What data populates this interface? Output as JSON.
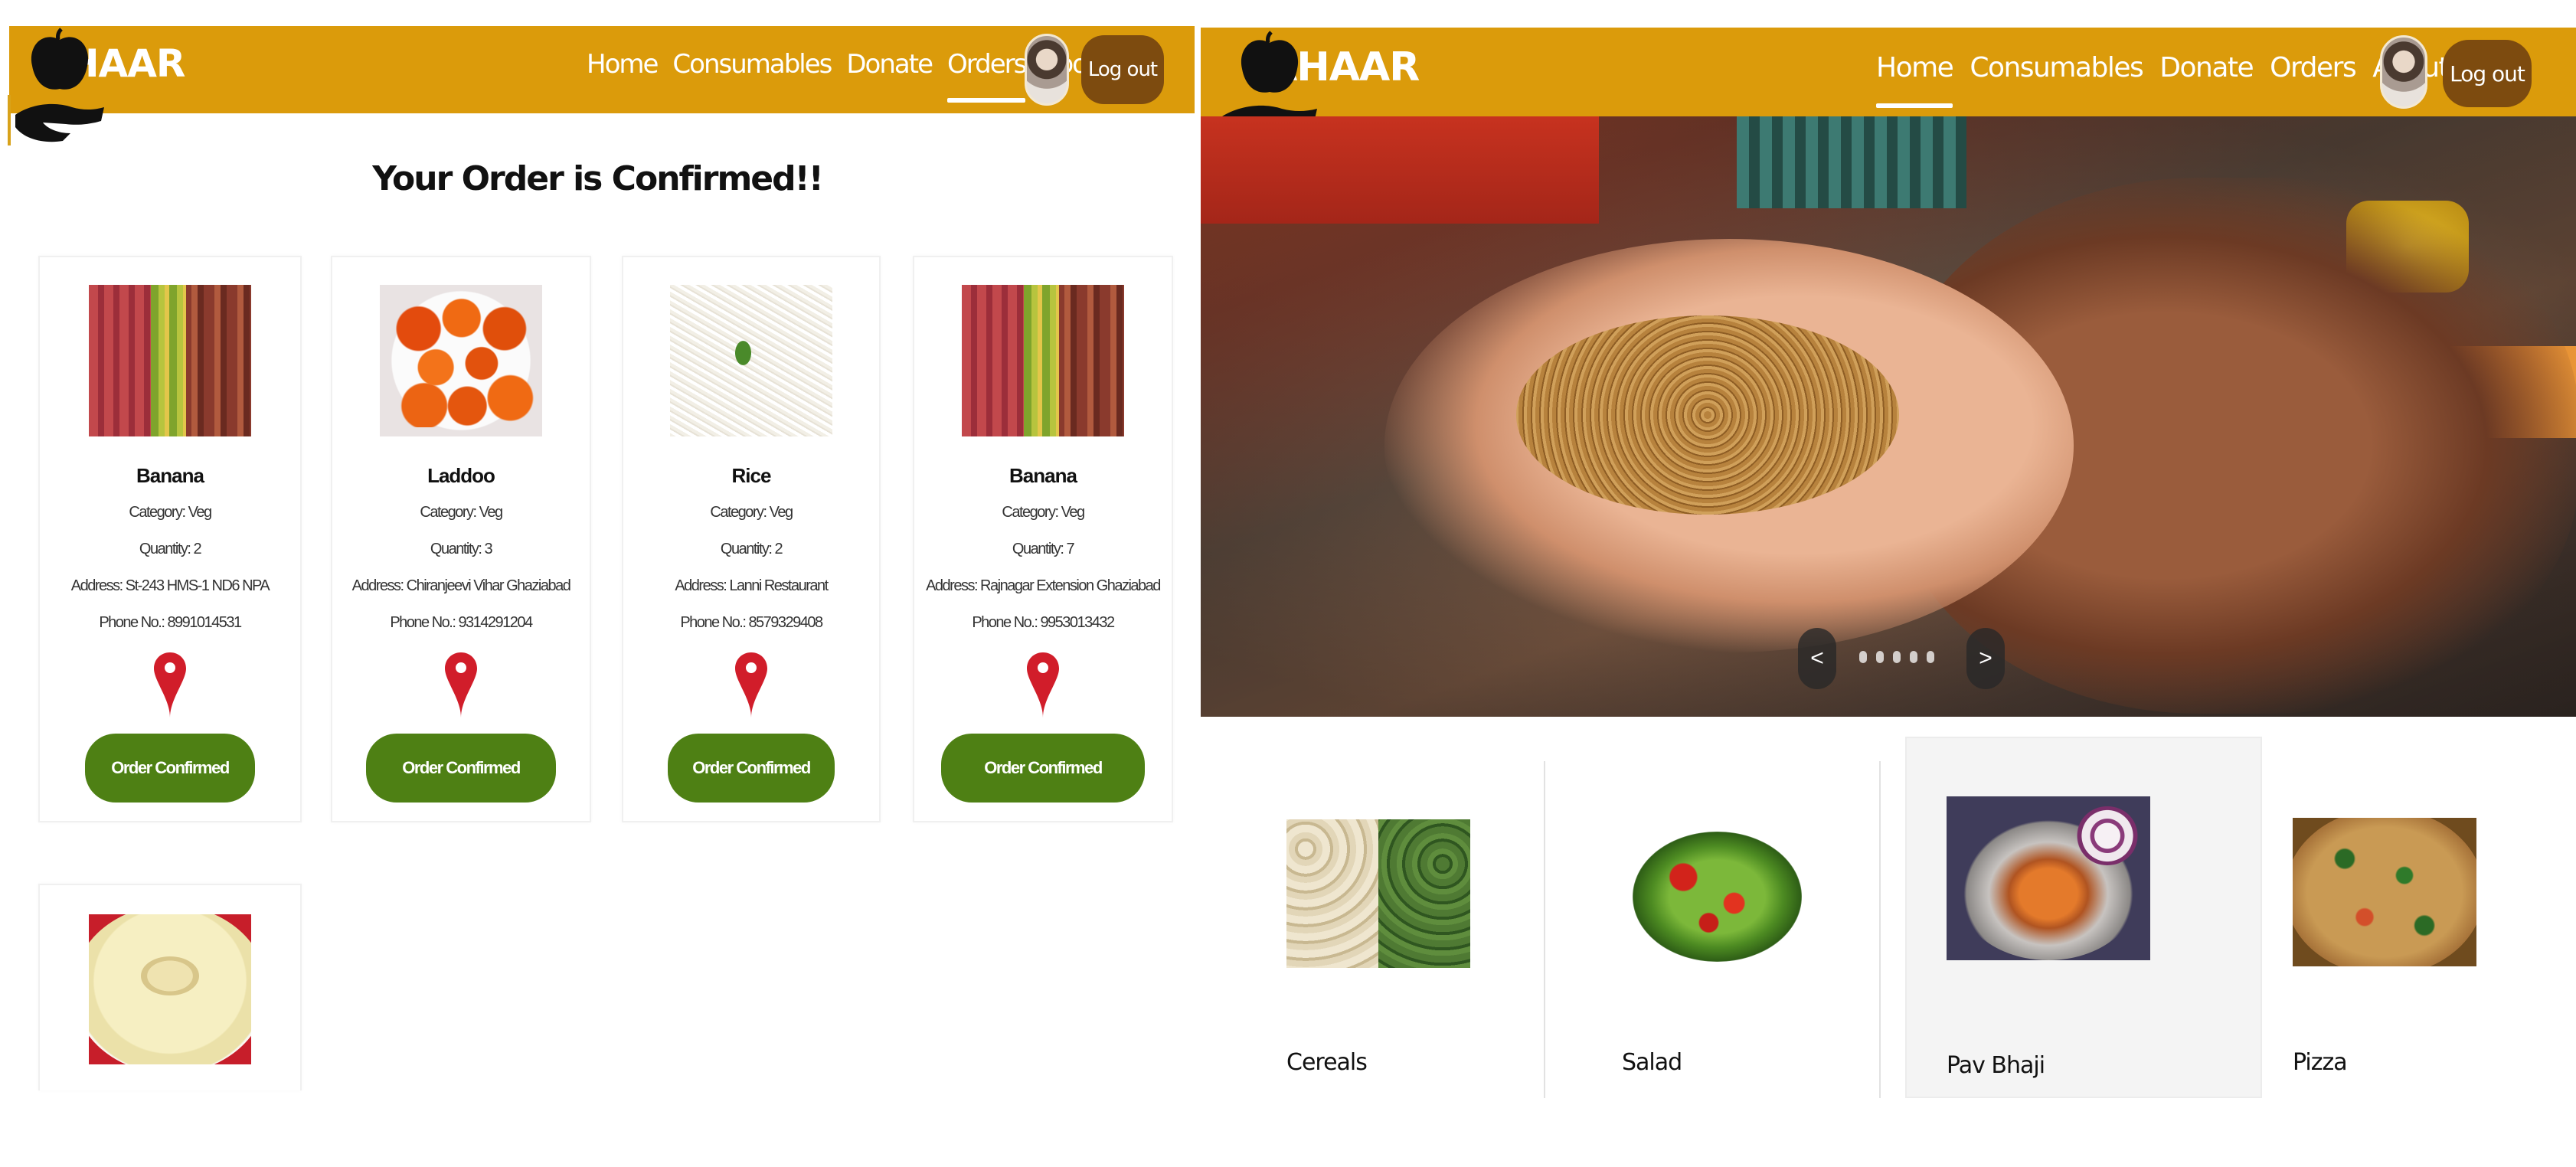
{
  "left": {
    "brand": "AHAAR",
    "nav": [
      "Home",
      "Consumables",
      "Donate",
      "Orders",
      "About"
    ],
    "active_nav": "Orders",
    "logout_label": "Log out",
    "page_title": "Your Order is Confirmed!!",
    "orders": [
      {
        "name": "Banana",
        "category": "Category: Veg",
        "quantity": "Quantity: 2",
        "address": "Address: St-243 HMS-1 ND6 NPA",
        "phone": "Phone No.: 8991014531",
        "button": "Order Confirmed",
        "image": "banana"
      },
      {
        "name": "Laddoo",
        "category": "Category: Veg",
        "quantity": "Quantity: 3",
        "address": "Address: Chiranjeevi Vihar Ghaziabad",
        "phone": "Phone No.: 9314291204",
        "button": "Order Confirmed",
        "image": "laddoo"
      },
      {
        "name": "Rice",
        "category": "Category: Veg",
        "quantity": "Quantity: 2",
        "address": "Address: Lanni Restaurant",
        "phone": "Phone No.: 8579329408",
        "button": "Order Confirmed",
        "image": "rice"
      },
      {
        "name": "Banana",
        "category": "Category: Veg",
        "quantity": "Quantity: 7",
        "address": "Address: Rajnagar Extension Ghaziabad",
        "phone": "Phone No.: 9953013432",
        "button": "Order Confirmed",
        "image": "banana"
      },
      {
        "image": "rasmalai"
      }
    ]
  },
  "right": {
    "brand": "AHAAR",
    "nav": [
      "Home",
      "Consumables",
      "Donate",
      "Orders",
      "About"
    ],
    "active_nav": "Home",
    "logout_label": "Log out",
    "carousel": {
      "prev": "<",
      "next": ">",
      "dot_count": 5
    },
    "categories": [
      {
        "label": "Cereals",
        "image": "cereals"
      },
      {
        "label": "Salad",
        "image": "salad"
      },
      {
        "label": "Pav Bhaji",
        "image": "pavbhaji"
      },
      {
        "label": "Pizza",
        "image": "pizza"
      }
    ]
  },
  "colors": {
    "navbar": "#db9b0b",
    "logout_button": "#7d4b0f",
    "confirm_button": "#4e8014",
    "pin": "#d11d2a"
  }
}
